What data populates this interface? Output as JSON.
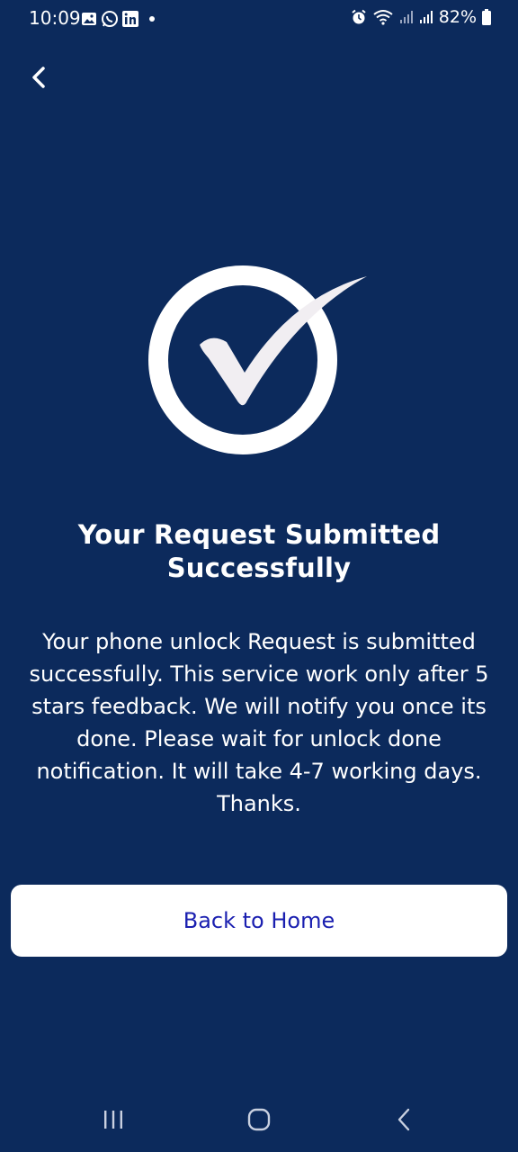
{
  "status_bar": {
    "time": "10:09",
    "battery": "82%",
    "left_icons": [
      "gallery-icon",
      "whatsapp-icon",
      "linkedin-icon",
      "notification-dot"
    ],
    "right_icons": [
      "alarm-icon",
      "wifi-icon",
      "signal-icon",
      "signal-icon",
      "battery-icon"
    ]
  },
  "header": {
    "back_icon": "chevron-left-icon"
  },
  "illustration": {
    "icon": "check-circle-icon",
    "circle_color": "#ffffff",
    "check_color": "#f1eef2"
  },
  "main": {
    "title": "Your Request Submitted Successfully",
    "message": "Your phone unlock Request is submitted successfully. This service work only after 5 stars feedback. We will notify you once its done. Please wait for unlock done notification. It will take 4-7 working days. Thanks."
  },
  "actions": {
    "home_label": "Back to Home"
  },
  "navigation_bar": {
    "items": [
      "recents-icon",
      "home-icon",
      "back-icon"
    ]
  },
  "colors": {
    "background": "#0c2a5c",
    "button_bg": "#ffffff",
    "button_text": "#1a1fb0"
  }
}
